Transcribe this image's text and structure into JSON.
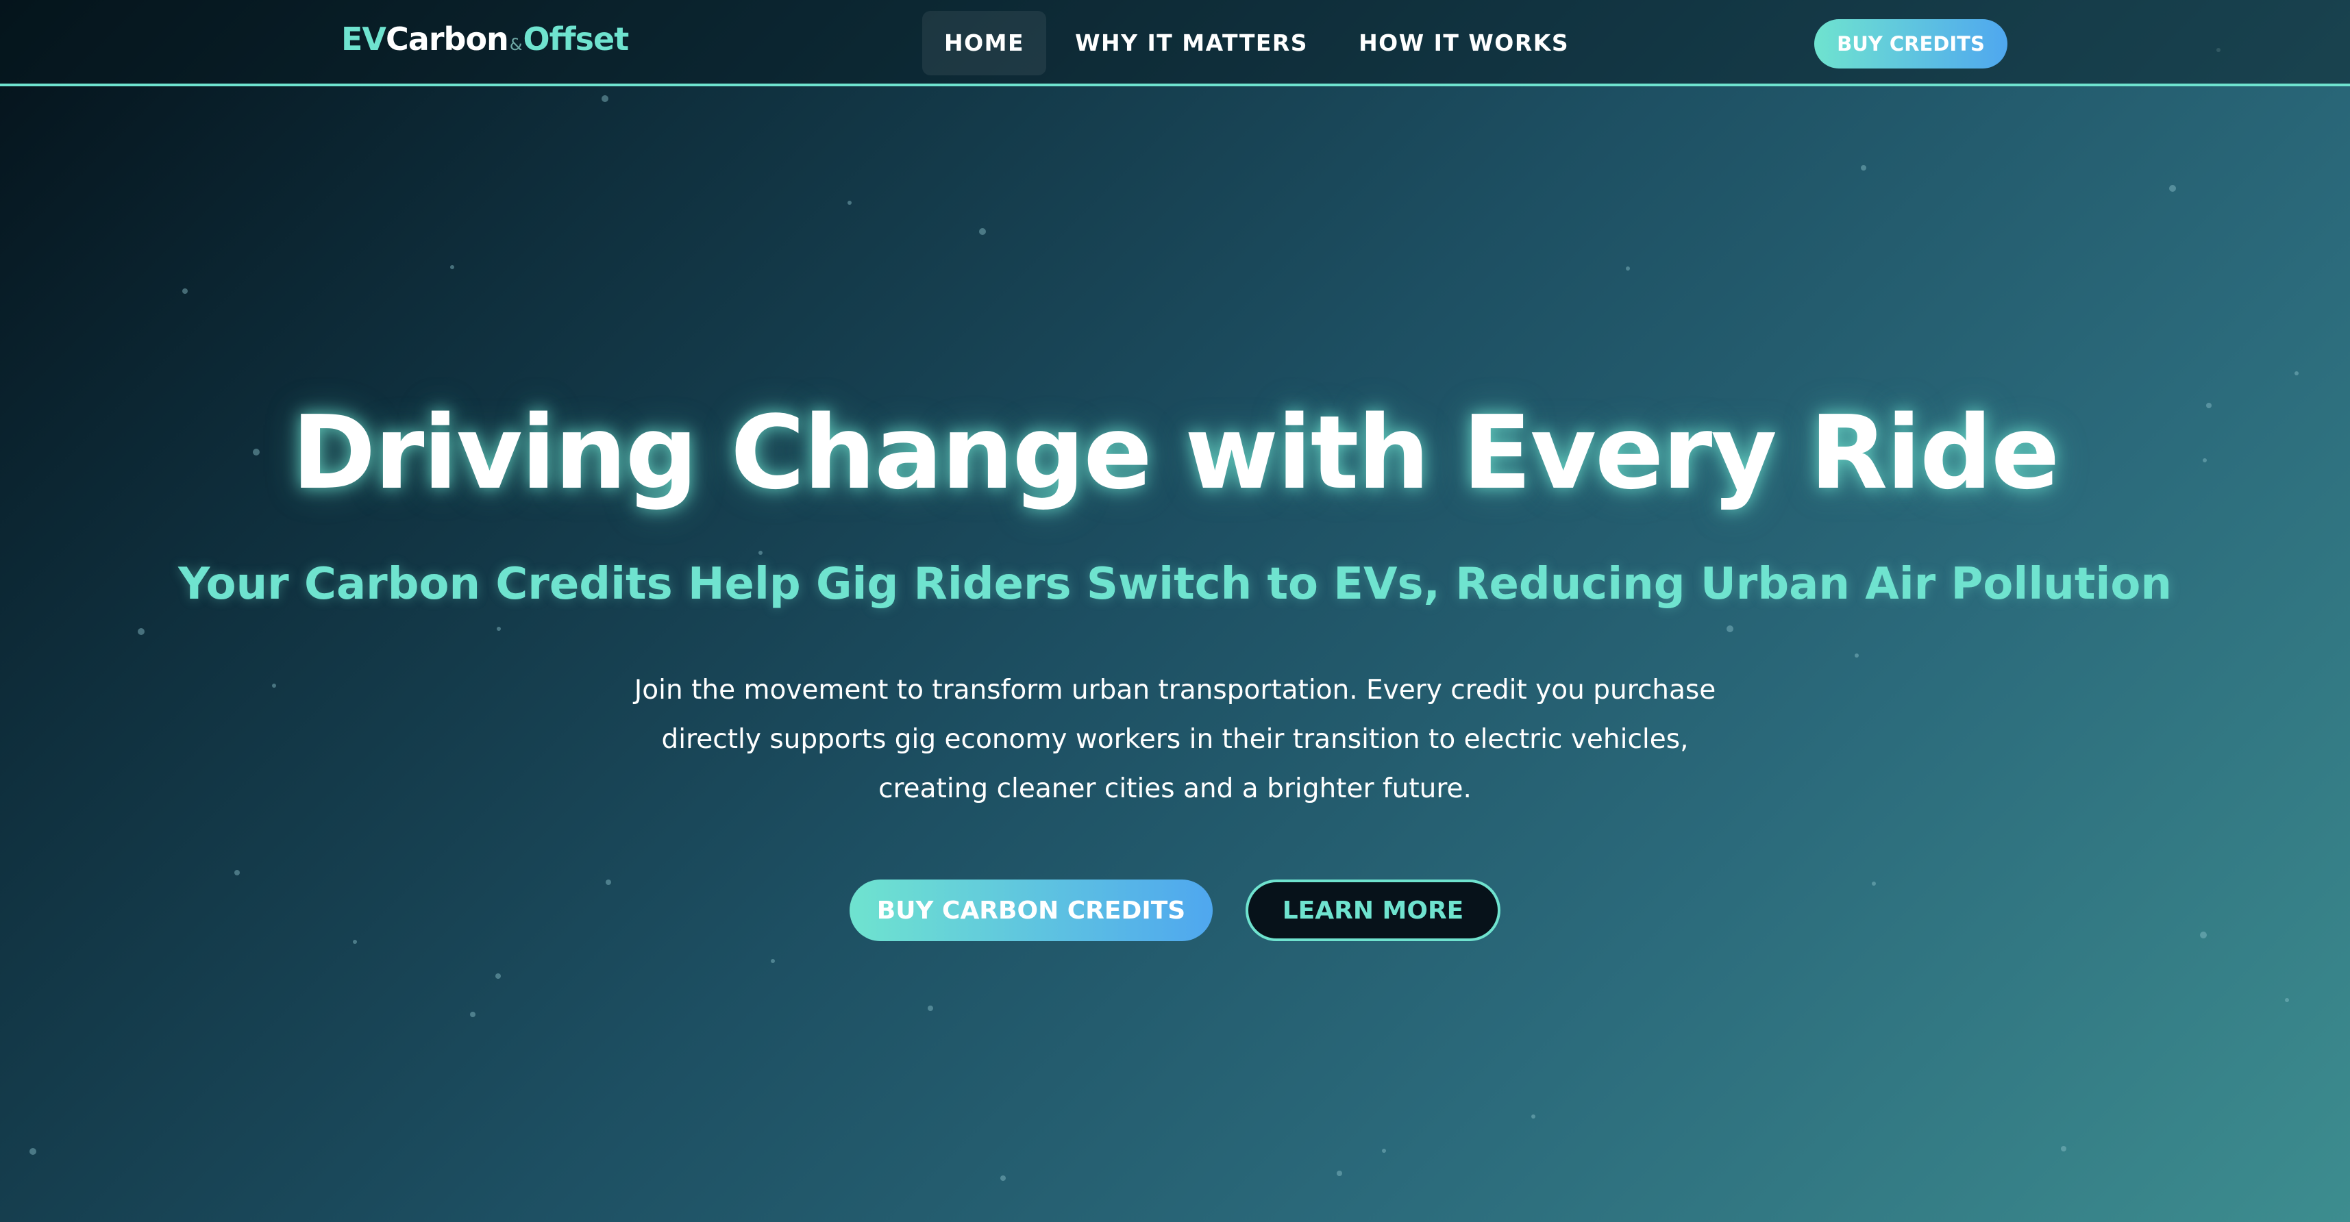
{
  "brand": {
    "part_ev": "EV",
    "part_carbon": "Carbon",
    "part_amp": "&",
    "part_offset": "Offset"
  },
  "nav": {
    "items": [
      {
        "label": "HOME",
        "active": true
      },
      {
        "label": "WHY IT MATTERS",
        "active": false
      },
      {
        "label": "HOW IT WORKS",
        "active": false
      }
    ],
    "cta_label": "BUY CREDITS"
  },
  "hero": {
    "title": "Driving Change with Every Ride",
    "subtitle": "Your Carbon Credits Help Gig Riders Switch to EVs, Reducing Urban Air Pollution",
    "description": "Join the movement to transform urban transportation. Every credit you purchase directly supports gig economy workers in their transition to electric vehicles, creating cleaner cities and a brighter future.",
    "primary_button": "BUY CARBON CREDITS",
    "secondary_button": "LEARN MORE"
  },
  "colors": {
    "accent": "#6fe3cf",
    "accent_blue": "#4fa7ef",
    "background_dark": "#04121a",
    "background_light": "#3d8d8f"
  }
}
